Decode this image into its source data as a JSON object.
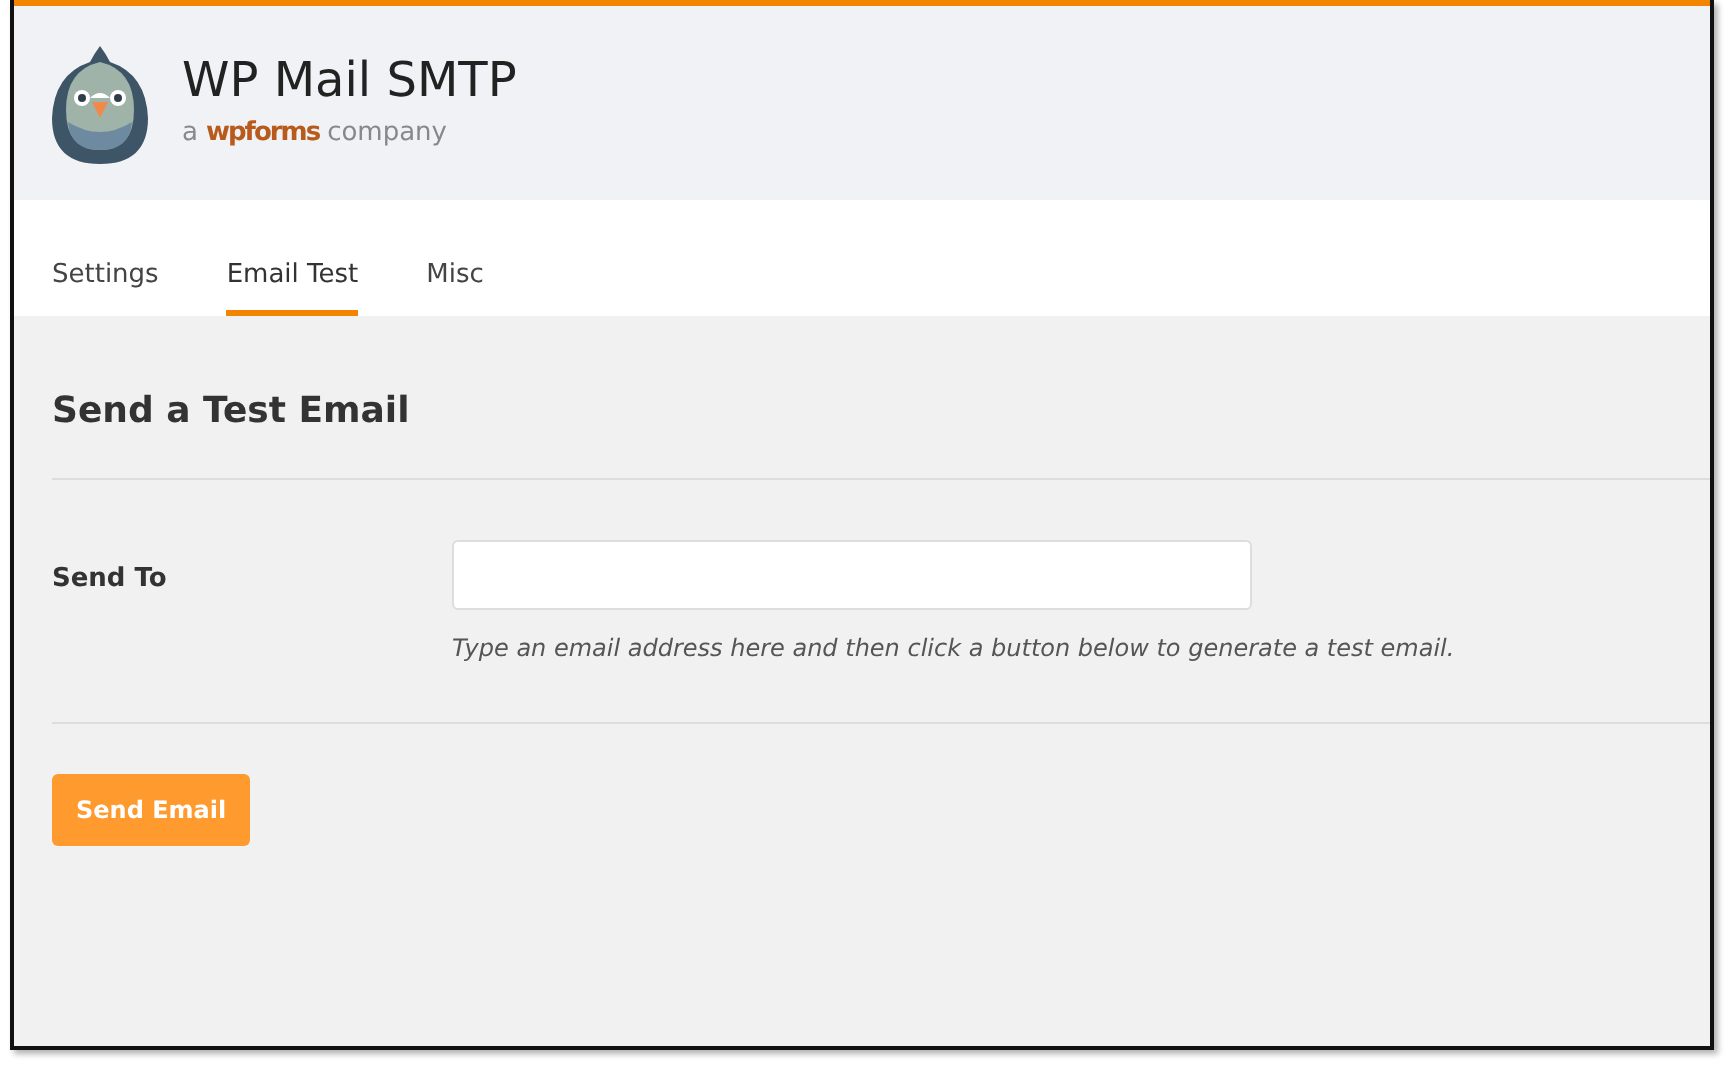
{
  "header": {
    "title": "WP Mail SMTP",
    "tagline_prefix": "a",
    "tagline_brand": "wpforms",
    "tagline_suffix": "company"
  },
  "tabs": [
    {
      "label": "Settings",
      "selected": false
    },
    {
      "label": "Email Test",
      "selected": true
    },
    {
      "label": "Misc",
      "selected": false
    }
  ],
  "section": {
    "heading": "Send a Test Email"
  },
  "fields": [
    {
      "label": "Send To",
      "help": "Type an email address here and then click a button below to generate a test email."
    }
  ],
  "buttons": [
    {
      "label": "Send Email"
    }
  ]
}
